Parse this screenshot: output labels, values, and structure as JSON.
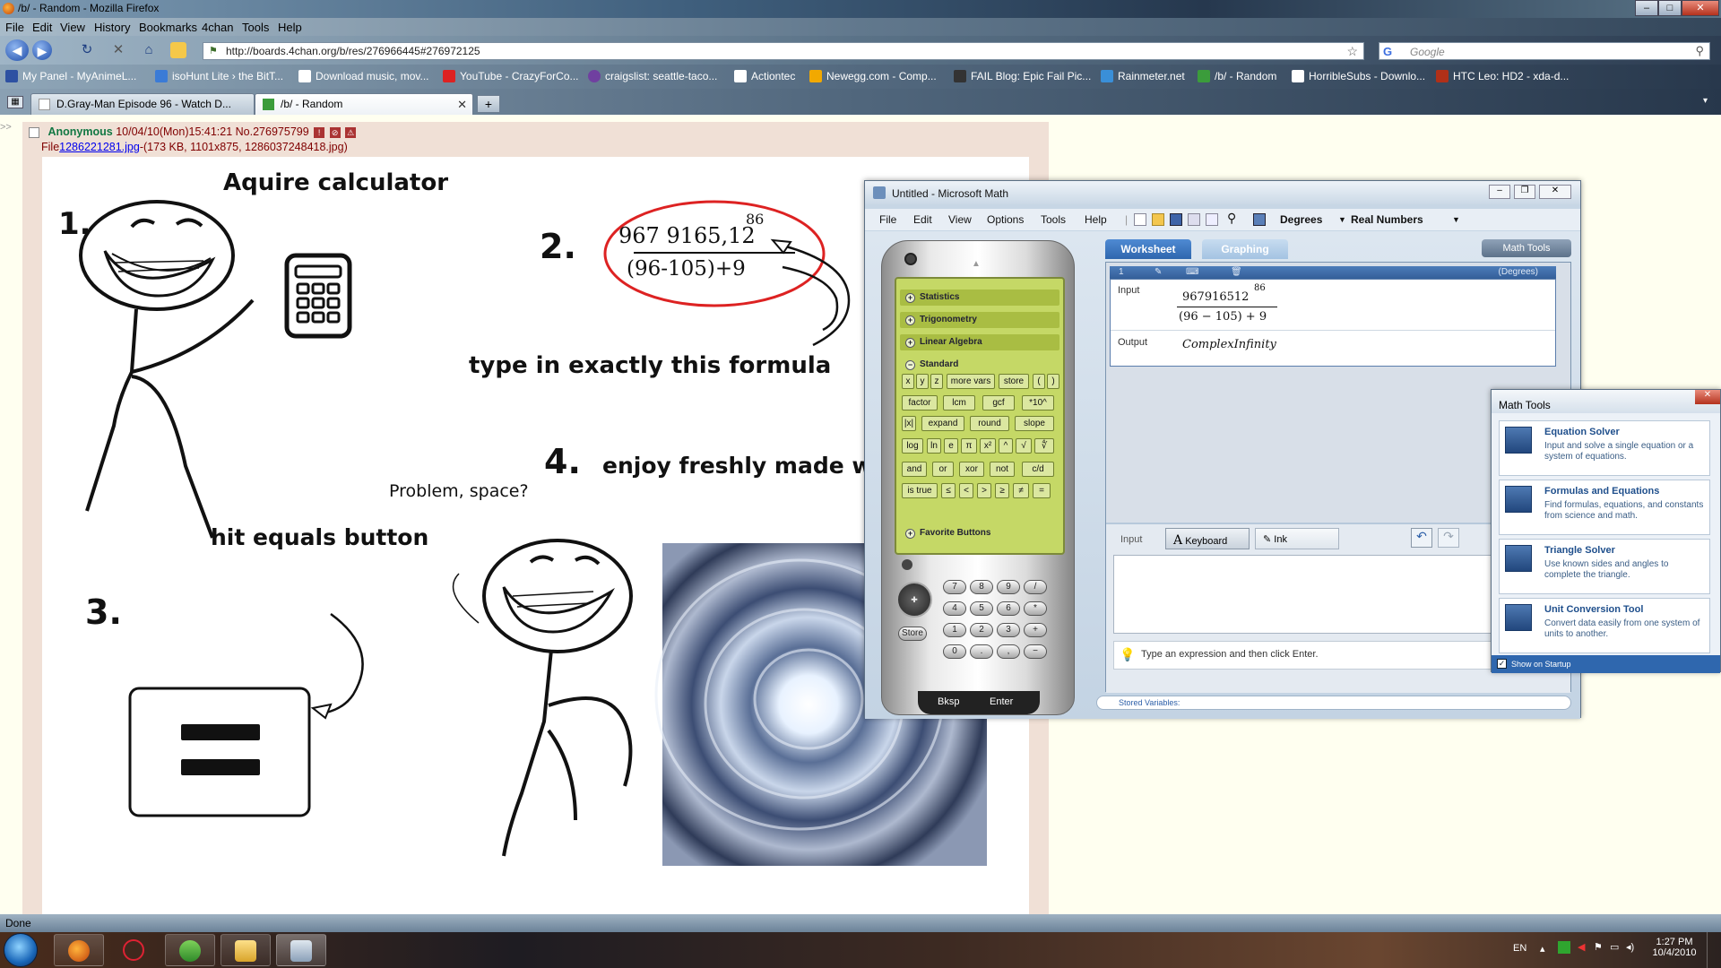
{
  "window": {
    "title": "/b/ - Random - Mozilla Firefox",
    "minimize": "–",
    "maximize": "□",
    "close": "✕"
  },
  "menu": [
    "File",
    "Edit",
    "View",
    "History",
    "Bookmarks",
    "4chan",
    "Tools",
    "Help"
  ],
  "nav": {
    "back": "◀",
    "forward": "▶",
    "reload": "↻",
    "stop": "✕",
    "home": "⌂",
    "url": "http://boards.4chan.org/b/res/276966445#276972125",
    "search_engine": "G",
    "search_placeholder": "Google"
  },
  "bookmarks": [
    {
      "label": "My Panel - MyAnimeL...",
      "color": "#2e51a2"
    },
    {
      "label": "isoHunt Lite › the BitT...",
      "color": "#3b7bd6"
    },
    {
      "label": "Download music, mov...",
      "color": "#ffffff"
    },
    {
      "label": "YouTube - CrazyForCo...",
      "color": "#d22"
    },
    {
      "label": "craigslist: seattle-taco...",
      "color": "#7040a0"
    },
    {
      "label": "Actiontec",
      "color": "#ffffff"
    },
    {
      "label": "Newegg.com - Comp...",
      "color": "#f2a900"
    },
    {
      "label": "FAIL Blog: Epic Fail Pic...",
      "color": "#333333"
    },
    {
      "label": "Rainmeter.net",
      "color": "#3a8fd8"
    },
    {
      "label": "/b/ - Random",
      "color": "#3b9c3b"
    },
    {
      "label": "HorribleSubs - Downlo...",
      "color": "#ffffff"
    },
    {
      "label": "HTC Leo: HD2 - xda-d...",
      "color": "#b03018"
    }
  ],
  "tabs": [
    {
      "label": "D.Gray-Man Episode 96 - Watch D...",
      "active": false
    },
    {
      "label": "/b/ - Random",
      "active": true
    }
  ],
  "post": {
    "gutter": ">>",
    "name": "Anonymous",
    "datetime": "10/04/10(Mon)15:41:21",
    "number": "No.276975799",
    "file_prefix": "File",
    "file_link": "1286221281.jpg",
    "file_meta": "-(173 KB, 1101x875, 1286037248418.jpg)"
  },
  "comic": {
    "step1": "1.",
    "step1_text": "Aquire calculator",
    "step2": "2.",
    "formula_num": "967 9165,12",
    "formula_exp": "86",
    "formula_den": "(96-105)+9",
    "step2_text": "type in exactly this formula",
    "step3": "3.",
    "step3_text": "hit equals button",
    "step4": "4.",
    "step4_text": "enjoy freshly made wo",
    "speech": "Problem, space?"
  },
  "mathwin": {
    "title": "Untitled - Microsoft Math",
    "menu": [
      "File",
      "Edit",
      "View",
      "Options",
      "Tools",
      "Help"
    ],
    "angle_mode": "Degrees",
    "number_mode": "Real Numbers",
    "tab_worksheet": "Worksheet",
    "tab_graphing": "Graphing",
    "math_tools_button": "Math Tools",
    "categories": {
      "statistics": "Statistics",
      "trigonometry": "Trigonometry",
      "linear_algebra": "Linear Algebra",
      "standard": "Standard",
      "favorites": "Favorite Buttons"
    },
    "keys_row1": [
      "x",
      "y",
      "z",
      "more vars",
      "store",
      "(",
      ")"
    ],
    "keys_row2": [
      "factor",
      "lcm",
      "gcf",
      "*10^"
    ],
    "keys_row3": [
      "|x|",
      "expand",
      "round",
      "slope"
    ],
    "keys_row4": [
      "log",
      "ln",
      "e",
      "π",
      "x²",
      "^",
      "√",
      "∜"
    ],
    "keys_row5": [
      "and",
      "or",
      "xor",
      "not",
      "c/d"
    ],
    "keys_row6": [
      "is true",
      "≤",
      "<",
      ">",
      "≥",
      "≠",
      "="
    ],
    "numpad": [
      "7",
      "8",
      "9",
      "/",
      "4",
      "5",
      "6",
      "*",
      "1",
      "2",
      "3",
      "+",
      "0",
      ".",
      ",",
      "−"
    ],
    "store": "Store",
    "bksp": "Bksp",
    "enter": "Enter",
    "ws_index": "1",
    "ws_mode": "(Degrees)",
    "input_label": "Input",
    "input_num": "967916512",
    "input_exp": "86",
    "input_den": "(96 − 105) + 9",
    "output_label": "Output",
    "output_value": "ComplexInfinity",
    "panel_input_label": "Input",
    "keyboard_button": "Keyboard",
    "ink_button": "Ink",
    "hint": "Type an expression and then click Enter.",
    "stored_vars": "Stored Variables:"
  },
  "mathtools": {
    "title": "Math Tools",
    "tools": [
      {
        "name": "Equation Solver",
        "desc": "Input and solve a single equation or a system of equations."
      },
      {
        "name": "Formulas and Equations",
        "desc": "Find formulas, equations, and constants from science and math."
      },
      {
        "name": "Triangle Solver",
        "desc": "Use known sides and angles to complete the triangle."
      },
      {
        "name": "Unit Conversion Tool",
        "desc": "Convert data easily from one system of units to another."
      }
    ],
    "show_on_startup": "Show on Startup"
  },
  "status": "Done",
  "tray": {
    "lang": "EN",
    "time": "1:27 PM",
    "date": "10/4/2010"
  }
}
